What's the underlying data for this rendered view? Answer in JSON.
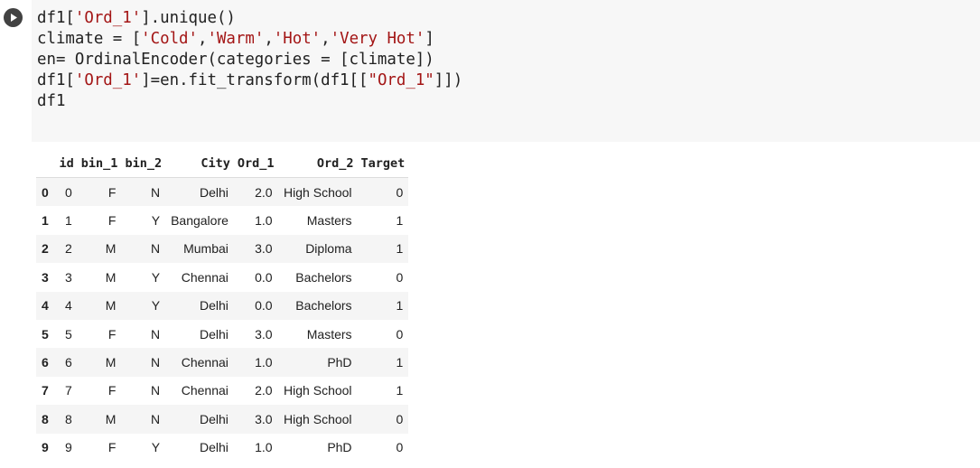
{
  "code_cell": {
    "lines": [
      [
        {
          "t": "df1[",
          "k": "plain"
        },
        {
          "t": "'Ord_1'",
          "k": "str"
        },
        {
          "t": "].unique()",
          "k": "plain"
        }
      ],
      [
        {
          "t": "climate = [",
          "k": "plain"
        },
        {
          "t": "'Cold'",
          "k": "str"
        },
        {
          "t": ",",
          "k": "plain"
        },
        {
          "t": "'Warm'",
          "k": "str"
        },
        {
          "t": ",",
          "k": "plain"
        },
        {
          "t": "'Hot'",
          "k": "str"
        },
        {
          "t": ",",
          "k": "plain"
        },
        {
          "t": "'Very Hot'",
          "k": "str"
        },
        {
          "t": "]",
          "k": "plain"
        }
      ],
      [
        {
          "t": "en= OrdinalEncoder(categories = [climate])",
          "k": "plain"
        }
      ],
      [
        {
          "t": "df1[",
          "k": "plain"
        },
        {
          "t": "'Ord_1'",
          "k": "str"
        },
        {
          "t": "]=en.fit_transform(df1[[",
          "k": "plain"
        },
        {
          "t": "\"Ord_1\"",
          "k": "str"
        },
        {
          "t": "]])",
          "k": "plain"
        }
      ],
      [
        {
          "t": "df1",
          "k": "plain"
        }
      ]
    ]
  },
  "dataframe": {
    "columns": [
      "",
      "id",
      "bin_1",
      "bin_2",
      "City",
      "Ord_1",
      "Ord_2",
      "Target"
    ],
    "rows": [
      [
        "0",
        "0",
        "F",
        "N",
        "Delhi",
        "2.0",
        "High School",
        "0"
      ],
      [
        "1",
        "1",
        "F",
        "Y",
        "Bangalore",
        "1.0",
        "Masters",
        "1"
      ],
      [
        "2",
        "2",
        "M",
        "N",
        "Mumbai",
        "3.0",
        "Diploma",
        "1"
      ],
      [
        "3",
        "3",
        "M",
        "Y",
        "Chennai",
        "0.0",
        "Bachelors",
        "0"
      ],
      [
        "4",
        "4",
        "M",
        "Y",
        "Delhi",
        "0.0",
        "Bachelors",
        "1"
      ],
      [
        "5",
        "5",
        "F",
        "N",
        "Delhi",
        "3.0",
        "Masters",
        "0"
      ],
      [
        "6",
        "6",
        "M",
        "N",
        "Chennai",
        "1.0",
        "PhD",
        "1"
      ],
      [
        "7",
        "7",
        "F",
        "N",
        "Chennai",
        "2.0",
        "High School",
        "1"
      ],
      [
        "8",
        "8",
        "M",
        "N",
        "Delhi",
        "3.0",
        "High School",
        "0"
      ],
      [
        "9",
        "9",
        "F",
        "Y",
        "Delhi",
        "1.0",
        "PhD",
        "0"
      ]
    ]
  },
  "colors": {
    "string_literal": "#a31515",
    "code_background": "#f7f7f7",
    "run_button": "#424242",
    "row_stripe": "#f5f5f5"
  },
  "icons": {
    "run_button": "play-icon"
  }
}
